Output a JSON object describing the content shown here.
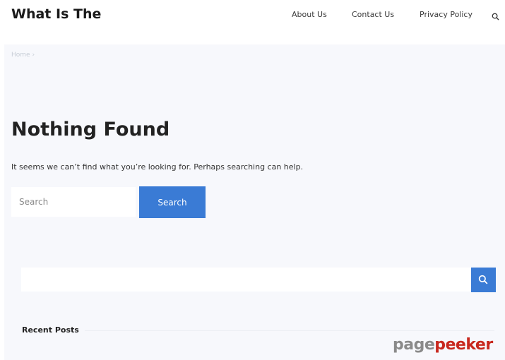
{
  "header": {
    "site_title": "What Is The",
    "nav": [
      "About Us",
      "Contact Us",
      "Privacy Policy"
    ],
    "search_icon": "search-icon"
  },
  "breadcrumb": {
    "home": "Home",
    "separator": "›"
  },
  "main": {
    "title": "Nothing Found",
    "message": "It seems we can’t find what you’re looking for. Perhaps searching can help.",
    "search_placeholder": "Search",
    "search_button": "Search"
  },
  "sidebar": {
    "search_icon": "search-icon",
    "recent_posts_title": "Recent Posts"
  },
  "watermark": {
    "part1": "page",
    "part2": "peeker"
  },
  "colors": {
    "accent": "#3a7bd5",
    "background": "#f7f8fc",
    "watermark_red": "#c8281e"
  }
}
